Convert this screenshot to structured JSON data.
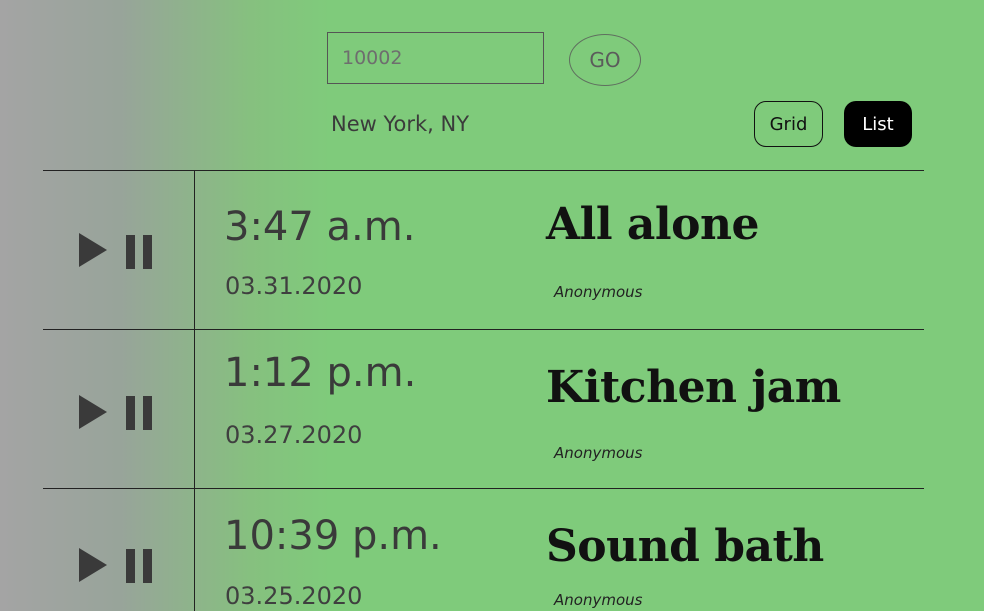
{
  "search": {
    "placeholder": "10002",
    "go_label": "GO"
  },
  "location": "New York, NY",
  "view_toggle": {
    "grid_label": "Grid",
    "list_label": "List",
    "selected": "List"
  },
  "icons": {
    "play": "play-icon",
    "pause": "pause-icon"
  },
  "colors": {
    "background": "#7fcb7b",
    "active_button": "#000000"
  },
  "recordings": [
    {
      "time": "3:47 a.m.",
      "date": "03.31.2020",
      "title": "All alone",
      "author": "Anonymous"
    },
    {
      "time": "1:12 p.m.",
      "date": "03.27.2020",
      "title": "Kitchen jam",
      "author": "Anonymous"
    },
    {
      "time": "10:39 p.m.",
      "date": "03.25.2020",
      "title": "Sound bath",
      "author": "Anonymous"
    }
  ]
}
